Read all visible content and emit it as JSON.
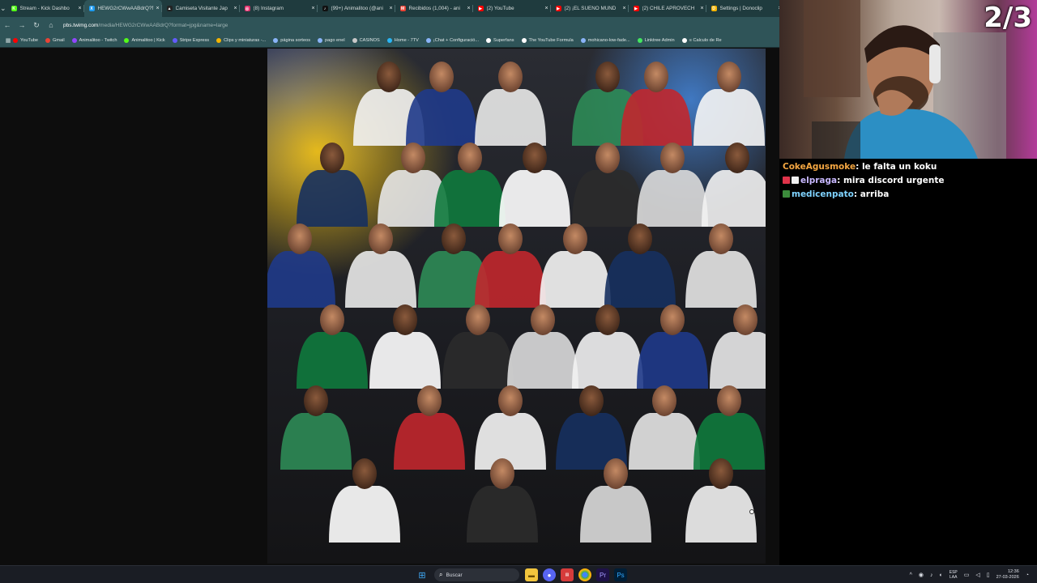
{
  "browser": {
    "tabs": [
      {
        "title": "Stream - Kick Dashbo",
        "color": "#53fc18",
        "glyph": "K"
      },
      {
        "title": "HEWG2rCWwAABdrQ?f",
        "color": "#1d9bf0",
        "glyph": "X",
        "active": true
      },
      {
        "title": "Camiseta Visitante Jap",
        "color": "#222222",
        "glyph": "▲"
      },
      {
        "title": "(8) Instagram",
        "color": "#e1306c",
        "glyph": "◎"
      },
      {
        "title": "(99+) Animalitoo (@ani",
        "color": "#111111",
        "glyph": "♪"
      },
      {
        "title": "Recibidos (1,004) - ani",
        "color": "#ea4335",
        "glyph": "M"
      },
      {
        "title": "(2) YouTube",
        "color": "#ff0000",
        "glyph": "▶"
      },
      {
        "title": "(2) ¡EL SUEÑO MUND",
        "color": "#ff0000",
        "glyph": "▶"
      },
      {
        "title": "(2) CHILE APROVECH",
        "color": "#ff0000",
        "glyph": "▶"
      },
      {
        "title": "Settings | Donoclip",
        "color": "#f5b400",
        "glyph": "D"
      }
    ],
    "url_host": "pbs.twimg.com",
    "url_path": "/media/HEWG2rCWwAABdrQ?format=jpg&name=large",
    "bookmarks": [
      {
        "label": "YouTube",
        "color": "#ff0000"
      },
      {
        "label": "Gmail",
        "color": "#ea4335"
      },
      {
        "label": "Animalitoo - Twitch",
        "color": "#9146ff"
      },
      {
        "label": "Animalitoo | Kick",
        "color": "#53fc18"
      },
      {
        "label": "Stripe Express",
        "color": "#635bff"
      },
      {
        "label": "Clips y miniaturas -...",
        "color": "#f5b400"
      },
      {
        "label": "página sorteos",
        "color": "#8ab4f8"
      },
      {
        "label": "pago enel",
        "color": "#8ab4f8"
      },
      {
        "label": "CASINOS",
        "color": "#c9c9c9"
      },
      {
        "label": "Home - 7TV",
        "color": "#29b6f6"
      },
      {
        "label": "¡Chat + Configuració...",
        "color": "#8ab4f8"
      },
      {
        "label": "Superfans",
        "color": "#ffffff"
      },
      {
        "label": "The YouTube Formula",
        "color": "#ffffff"
      },
      {
        "label": "mohicano-low-fade...",
        "color": "#8ab4f8"
      },
      {
        "label": "Linktree Admin",
        "color": "#43e660"
      },
      {
        "label": "≡ Calculo de Re",
        "color": "#ffffff"
      }
    ]
  },
  "stream": {
    "counter": "2/3"
  },
  "chat": [
    {
      "user": "CokeAgusmoke",
      "user_color": "#f5a742",
      "message": " le falta un koku",
      "badges": []
    },
    {
      "user": "elpraga",
      "user_color": "#c8b8ff",
      "message": " mira discord urgente",
      "badges": [
        "#e0334a",
        "#f0f0f0"
      ]
    },
    {
      "user": "medicenpato",
      "user_color": "#7fd3ff",
      "message": " arriba",
      "badges": [
        "#3c8c3c"
      ]
    }
  ],
  "taskbar": {
    "search_placeholder": "Buscar",
    "lang_top": "ESP",
    "lang_bottom": "LAA",
    "time": "12:36",
    "date": "27-03-2026"
  }
}
